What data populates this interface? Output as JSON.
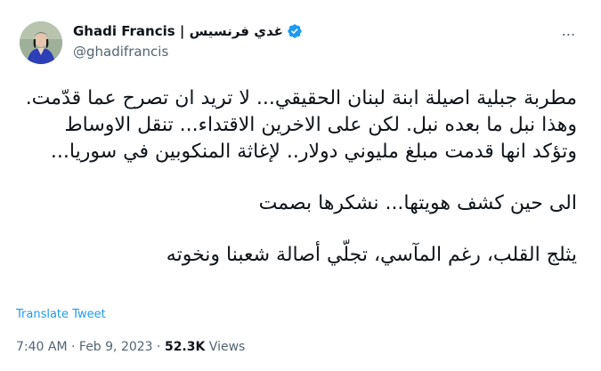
{
  "author": {
    "display_name": "Ghadi Francis | غدي فرنسيس",
    "handle": "@ghadifrancis",
    "verified_icon": "verified-badge-icon",
    "avatar_icon": "avatar"
  },
  "menu": {
    "more_label": "⋯",
    "icon": "more-options-icon"
  },
  "tweet": {
    "paragraph1": "مطربة جبلية اصيلة ابنة لبنان الحقيقي... لا تريد ان تصرح عما قدّمت. وهذا نبل ما بعده نبل. لكن على الاخرين الاقتداء... تنقل الاوساط وتؤكد انها قدمت مبلغ مليوني دولار.. لإغاثة المنكوبين في سوريا...",
    "paragraph2": "الى حين كشف هويتها... نشكرها بصمت",
    "paragraph3": "يثلج القلب، رغم المآسي، تجلّي أصالة شعبنا ونخوته"
  },
  "translate_label": "Translate Tweet",
  "meta": {
    "time": "7:40 AM",
    "sep1": " · ",
    "date": "Feb 9, 2023",
    "sep2": " · ",
    "views_count": "52.3K",
    "views_label": " Views"
  },
  "colors": {
    "accent": "#1d9bf0",
    "text": "#0f1419",
    "secondary": "#536471"
  }
}
